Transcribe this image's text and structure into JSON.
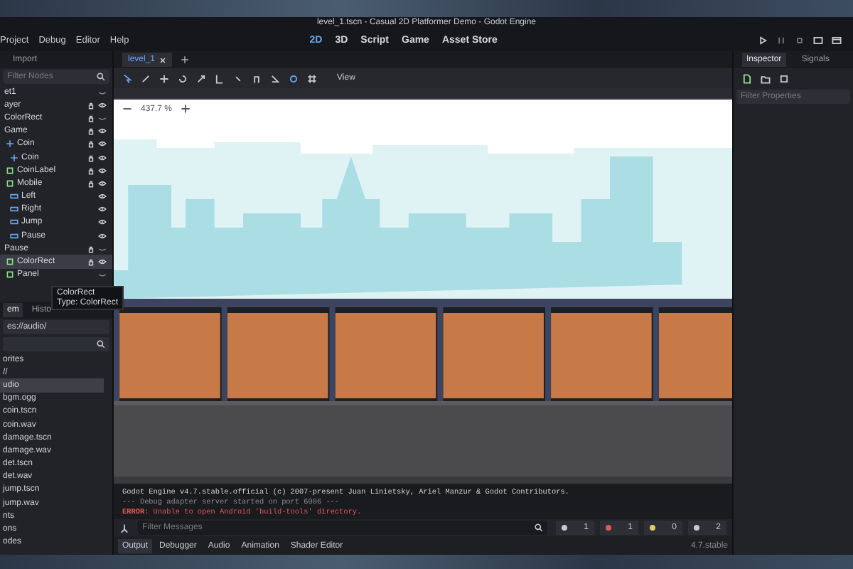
{
  "window": {
    "title": "level_1.tscn - Casual 2D Platformer Demo - Godot Engine"
  },
  "menu": [
    "Project",
    "Debug",
    "Editor",
    "Help"
  ],
  "workspaces": [
    {
      "label": "2D",
      "selected": true
    },
    {
      "label": "3D",
      "selected": false
    },
    {
      "label": "Script",
      "selected": false
    },
    {
      "label": "Game",
      "selected": false
    },
    {
      "label": "Asset Store",
      "selected": false
    }
  ],
  "scene_dock": {
    "tab": "Import",
    "filter": {
      "placeholder": "Filter Nodes"
    },
    "tree": [
      {
        "name": "et1",
        "locked": false,
        "visible": false,
        "children": [
          {
            "name": "ayer",
            "locked": true,
            "visible": true
          },
          {
            "name": "ColorRect",
            "locked": true,
            "visible": false
          },
          {
            "name": "Game",
            "locked": true,
            "visible": true,
            "children": [
              {
                "name": "Coin",
                "kind": "node2d",
                "locked": true,
                "visible": true,
                "children": [
                  {
                    "name": "Coin",
                    "kind": "node2d",
                    "locked": true,
                    "visible": true
                  }
                ]
              },
              {
                "name": "CoinLabel",
                "kind": "control",
                "locked": true,
                "visible": true
              },
              {
                "name": "Mobile",
                "kind": "control",
                "locked": true,
                "visible": true,
                "children": [
                  {
                    "name": "Left",
                    "kind": "button",
                    "locked": false,
                    "visible": true
                  },
                  {
                    "name": "Right",
                    "kind": "button",
                    "locked": false,
                    "visible": true
                  },
                  {
                    "name": "Jump",
                    "kind": "button",
                    "locked": false,
                    "visible": true
                  },
                  {
                    "name": "Pause",
                    "kind": "button",
                    "locked": false,
                    "visible": true
                  }
                ]
              }
            ]
          },
          {
            "name": "Pause",
            "locked": true,
            "visible": false,
            "children": [
              {
                "name": "ColorRect",
                "kind": "control",
                "locked": true,
                "visible": true,
                "selected": true
              },
              {
                "name": "Panel",
                "kind": "control",
                "locked": false,
                "visible": false
              }
            ]
          }
        ]
      }
    ],
    "tooltip": {
      "title": "ColorRect",
      "type": "Type: ColorRect"
    }
  },
  "file_dock": {
    "tabs": [
      {
        "label": "em",
        "selected": true
      },
      {
        "label": "Histo",
        "selected": false
      }
    ],
    "path": "es://audio/",
    "items": [
      {
        "name": "orites",
        "selected": false
      },
      {
        "name": "//",
        "selected": false
      },
      {
        "name": "udio",
        "selected": true
      },
      {
        "name": "bgm.ogg",
        "selected": false
      },
      {
        "name": "coin.tscn",
        "selected": false
      },
      {
        "name": "coin.wav",
        "selected": false
      },
      {
        "name": "damage.tscn",
        "selected": false
      },
      {
        "name": "damage.wav",
        "selected": false
      },
      {
        "name": "det.tscn",
        "selected": false
      },
      {
        "name": "det.wav",
        "selected": false
      },
      {
        "name": "jump.tscn",
        "selected": false
      },
      {
        "name": "jump.wav",
        "selected": false
      },
      {
        "name": "nts",
        "selected": false
      },
      {
        "name": "ons",
        "selected": false
      },
      {
        "name": "odes",
        "selected": false
      }
    ]
  },
  "scene_tab": {
    "label": "level_1"
  },
  "viewport": {
    "view_menu": "View",
    "zoom": "437.7 %"
  },
  "console": {
    "lines": [
      {
        "kind": "info",
        "text": "Godot Engine v4.7.stable.official (c) 2007-present Juan Linietsky, Ariel Manzur & Godot Contributors."
      },
      {
        "kind": "debug",
        "text": "--- Debug adapter server started on port 6006 ---"
      },
      {
        "kind": "error",
        "text": "**ERROR:** Unable to open Android 'build-tools' directory."
      }
    ],
    "filter": {
      "placeholder": "Filter Messages"
    },
    "counts": [
      {
        "kind": "log",
        "count": "1"
      },
      {
        "kind": "error",
        "count": "1"
      },
      {
        "kind": "warning",
        "count": "0"
      },
      {
        "kind": "editor",
        "count": "2"
      }
    ]
  },
  "bottom_tabs": [
    {
      "label": "Output",
      "selected": true
    },
    {
      "label": "Debugger",
      "selected": false
    },
    {
      "label": "Audio",
      "selected": false
    },
    {
      "label": "Animation",
      "selected": false
    },
    {
      "label": "Shader Editor",
      "selected": false
    }
  ],
  "version": "4.7.stable",
  "inspector": {
    "tabs": [
      {
        "label": "Inspector",
        "selected": true
      },
      {
        "label": "Signals",
        "selected": false
      }
    ],
    "filter": {
      "placeholder": "Filter Properties"
    }
  }
}
